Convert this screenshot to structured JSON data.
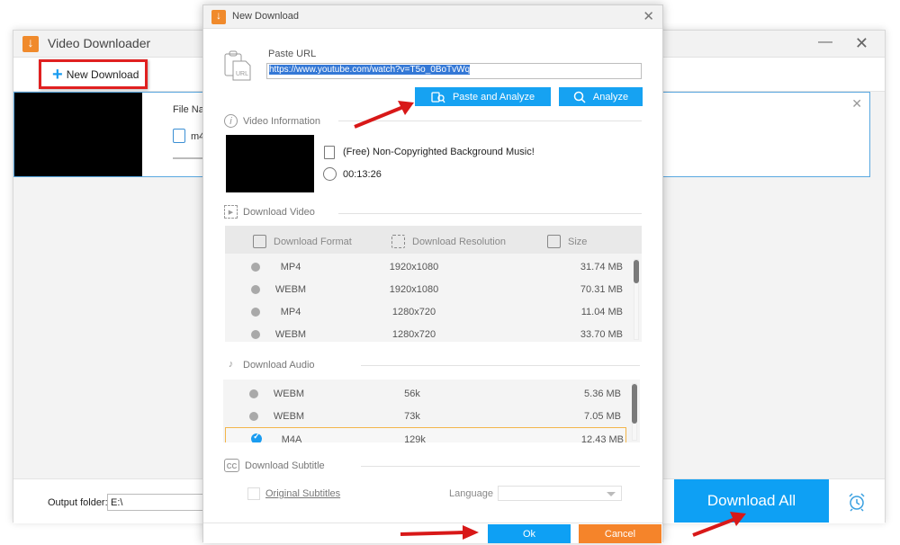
{
  "main_window": {
    "title": "Video Downloader",
    "minimize_icon": "—",
    "close_icon": "✕",
    "toolbar": {
      "new_download_label": "New Download",
      "plus_icon": "+"
    },
    "task": {
      "file_name_label": "File Na",
      "format": "m4",
      "close_icon": "✕"
    },
    "output_folder": {
      "label": "Output folder:",
      "value": "E:\\"
    },
    "download_all_label": "Download All"
  },
  "dialog": {
    "title": "New Download",
    "close_icon": "✕",
    "paste_url_label": "Paste URL",
    "url_value": "https://www.youtube.com/watch?v=T5o_0BoTvWq",
    "paste_analyze_label": "Paste and Analyze",
    "analyze_label": "Analyze",
    "video_info": {
      "heading": "Video Information",
      "title": "(Free) Non-Copyrighted Background Music!",
      "duration": "00:13:26"
    },
    "download_video": {
      "heading": "Download Video",
      "columns": [
        "Download Format",
        "Download Resolution",
        "Size"
      ],
      "rows": [
        {
          "format": "MP4",
          "resolution": "1920x1080",
          "size": "31.74 MB"
        },
        {
          "format": "WEBM",
          "resolution": "1920x1080",
          "size": "70.31 MB"
        },
        {
          "format": "MP4",
          "resolution": "1280x720",
          "size": "11.04 MB"
        },
        {
          "format": "WEBM",
          "resolution": "1280x720",
          "size": "33.70 MB"
        }
      ]
    },
    "download_audio": {
      "heading": "Download Audio",
      "rows": [
        {
          "format": "WEBM",
          "bitrate": "56k",
          "size": "5.36 MB",
          "selected": false
        },
        {
          "format": "WEBM",
          "bitrate": "73k",
          "size": "7.05 MB",
          "selected": false
        },
        {
          "format": "M4A",
          "bitrate": "129k",
          "size": "12.43 MB",
          "selected": true
        }
      ]
    },
    "download_subtitle": {
      "heading": "Download Subtitle",
      "original_subtitles_label": "Original Subtitles",
      "language_label": "Language",
      "language_value": ""
    },
    "ok_label": "Ok",
    "cancel_label": "Cancel"
  },
  "colors": {
    "accent_blue": "#0ea0f4",
    "cancel_orange": "#f5842a",
    "logo_orange": "#f08a2c",
    "highlight_red": "#e02020",
    "selected_row_border": "#f3b54a"
  }
}
